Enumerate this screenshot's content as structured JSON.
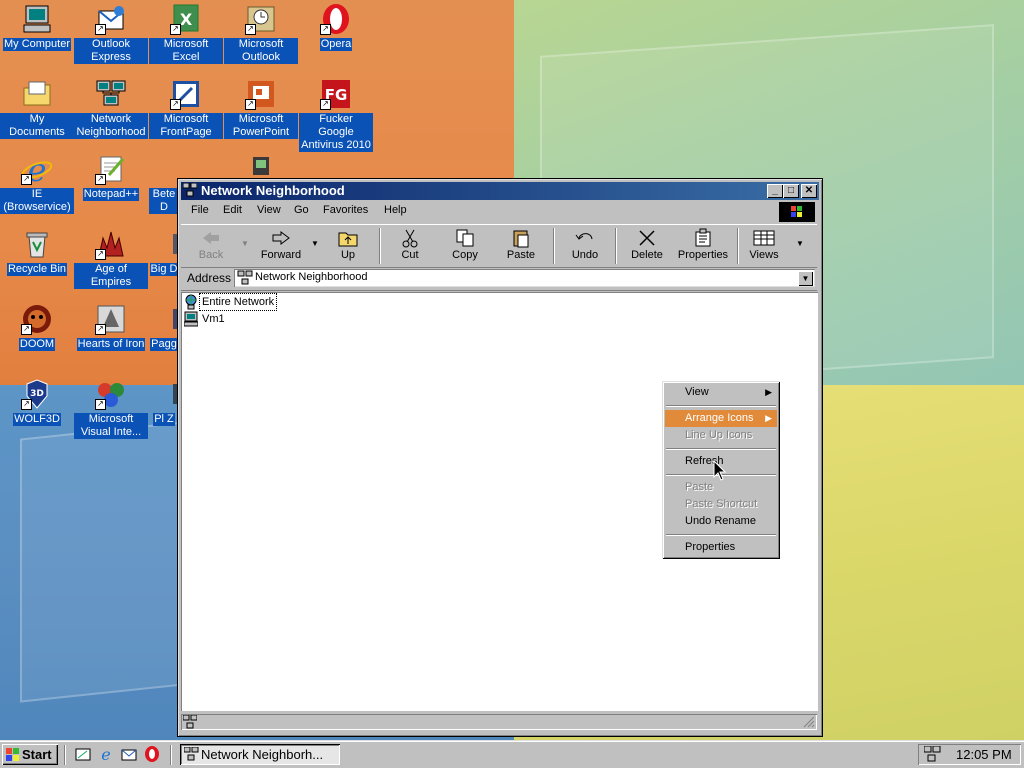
{
  "desktop": {
    "icons": [
      {
        "label": "My Computer"
      },
      {
        "label": "Outlook Express"
      },
      {
        "label": "Microsoft Excel"
      },
      {
        "label": "Microsoft Outlook"
      },
      {
        "label": "Opera"
      },
      {
        "label": "My Documents"
      },
      {
        "label": "Network Neighborhood"
      },
      {
        "label": "Microsoft FrontPage"
      },
      {
        "label": "Microsoft PowerPoint"
      },
      {
        "label": "Fucker Google Antivirus 2010"
      },
      {
        "label": "IE (Browservice)"
      },
      {
        "label": "Notepad++"
      },
      {
        "label": "Bete D"
      },
      {
        "label": "Recycle Bin"
      },
      {
        "label": "Age of Empires"
      },
      {
        "label": "Big D"
      },
      {
        "label": "DOOM"
      },
      {
        "label": "Hearts of Iron"
      },
      {
        "label": "Pagg"
      },
      {
        "label": "WOLF3D"
      },
      {
        "label": "Microsoft Visual Inte..."
      },
      {
        "label": "Pl Z"
      }
    ]
  },
  "window": {
    "title": "Network Neighborhood",
    "menu": [
      "File",
      "Edit",
      "View",
      "Go",
      "Favorites",
      "Help"
    ],
    "toolbar": {
      "back": "Back",
      "forward": "Forward",
      "up": "Up",
      "cut": "Cut",
      "copy": "Copy",
      "paste": "Paste",
      "undo": "Undo",
      "delete": "Delete",
      "properties": "Properties",
      "views": "Views"
    },
    "address": {
      "label": "Address",
      "value": "Network Neighborhood"
    },
    "items": [
      {
        "label": "Entire Network"
      },
      {
        "label": "Vm1"
      }
    ]
  },
  "context_menu": {
    "items": [
      {
        "label": "View",
        "submenu": true,
        "enabled": true
      },
      {
        "label": "Arrange Icons",
        "submenu": true,
        "enabled": true,
        "highlighted": true
      },
      {
        "label": "Line Up Icons",
        "enabled": false
      },
      {
        "label": "Refresh",
        "enabled": true
      },
      {
        "label": "Paste",
        "enabled": false
      },
      {
        "label": "Paste Shortcut",
        "enabled": false
      },
      {
        "label": "Undo Rename",
        "enabled": true
      },
      {
        "label": "Properties",
        "enabled": true
      }
    ]
  },
  "taskbar": {
    "start_label": "Start",
    "task_label": "Network Neighborh...",
    "clock": "12:05 PM"
  },
  "colors": {
    "title_bar_start": "#0a246a",
    "title_bar_end": "#3a6ea5",
    "menu_highlight": "#e08a3a",
    "desktop_label_bg": "#0a52b5"
  }
}
